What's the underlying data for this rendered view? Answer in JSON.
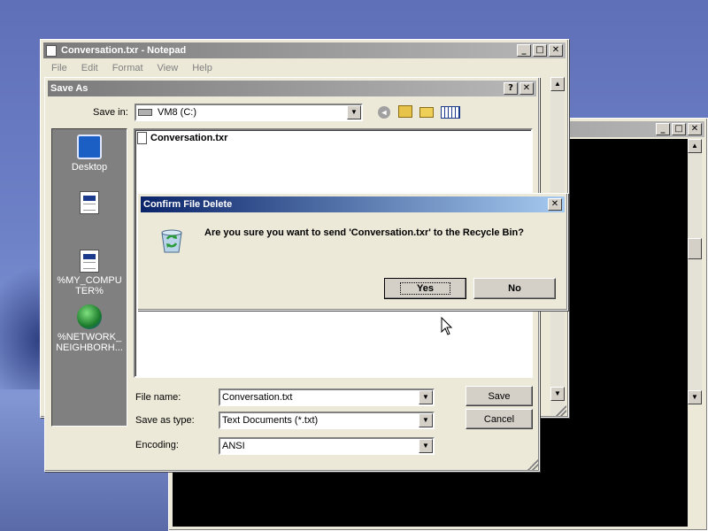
{
  "notepad": {
    "title": "Conversation.txr - Notepad",
    "menu": [
      "File",
      "Edit",
      "Format",
      "View",
      "Help"
    ]
  },
  "console": {
    "title": ""
  },
  "save_as": {
    "title": "Save As",
    "save_in_label": "Save in:",
    "save_in_value": "VM8 (C:)",
    "places": [
      {
        "label": "Desktop",
        "icon": "desktop-icon"
      },
      {
        "label": "",
        "icon": "document-icon"
      },
      {
        "label": "%MY_COMPUTER%",
        "icon": "document-icon"
      },
      {
        "label": "%NETWORK_NEIGHBORH...",
        "icon": "network-icon"
      }
    ],
    "files": [
      "Conversation.txr"
    ],
    "file_name_label": "File name:",
    "file_name_value": "Conversation.txt",
    "save_type_label": "Save as type:",
    "save_type_value": "Text Documents (*.txt)",
    "encoding_label": "Encoding:",
    "encoding_value": "ANSI",
    "save_button": "Save",
    "cancel_button": "Cancel"
  },
  "confirm": {
    "title": "Confirm File Delete",
    "message": "Are you sure you want to send 'Conversation.txr' to the Recycle Bin?",
    "yes_button": "Yes",
    "no_button": "No"
  },
  "colors": {
    "active_title": "#0a246a",
    "inactive_title": "#7a7a7a",
    "face": "#d4d0c8"
  }
}
